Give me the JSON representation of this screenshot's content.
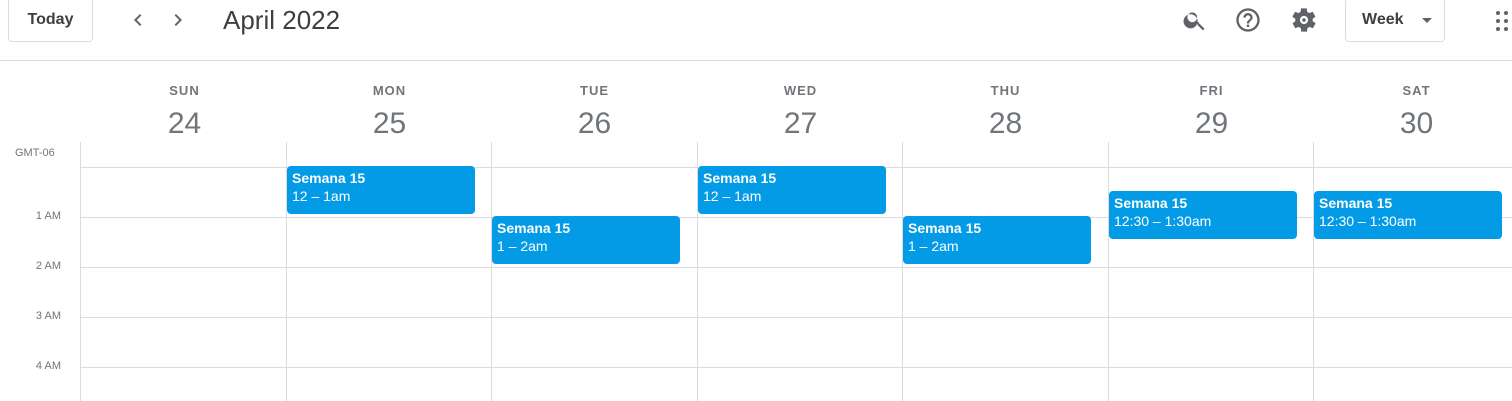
{
  "header": {
    "today_label": "Today",
    "month_title": "April 2022",
    "view_label": "Week"
  },
  "icons": {
    "prev": "chevron-left-icon",
    "next": "chevron-right-icon",
    "search": "search-icon",
    "help": "help-icon",
    "settings": "gear-icon",
    "view_dropdown": "caret-down-icon",
    "apps": "apps-grid-icon"
  },
  "grid": {
    "timezone": "GMT-06",
    "hours": [
      "1 AM",
      "2 AM",
      "3 AM",
      "4 AM"
    ]
  },
  "days": [
    {
      "name": "SUN",
      "date": "24"
    },
    {
      "name": "MON",
      "date": "25"
    },
    {
      "name": "TUE",
      "date": "26"
    },
    {
      "name": "WED",
      "date": "27"
    },
    {
      "name": "THU",
      "date": "28"
    },
    {
      "name": "FRI",
      "date": "29"
    },
    {
      "name": "SAT",
      "date": "30"
    }
  ],
  "events": [
    {
      "title": "Semana 15",
      "time": "12 – 1am"
    },
    {
      "title": "Semana 15",
      "time": "1 – 2am"
    },
    {
      "title": "Semana 15",
      "time": "12 – 1am"
    },
    {
      "title": "Semana 15",
      "time": "1 – 2am"
    },
    {
      "title": "Semana 15",
      "time": "12:30 – 1:30am"
    },
    {
      "title": "Semana 15",
      "time": "12:30 – 1:30am"
    }
  ],
  "colors": {
    "event": "#039be5",
    "grid_line": "#dadce0",
    "secondary_text": "#70757a"
  }
}
